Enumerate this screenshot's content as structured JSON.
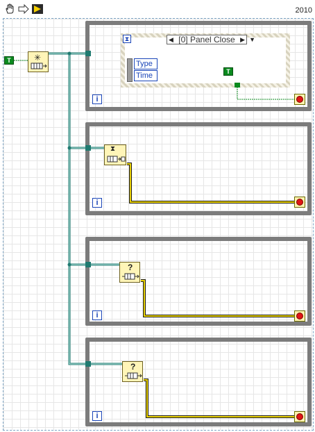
{
  "toolbar": {
    "icons": [
      "hand-cursor-icon",
      "arrow-right-icon",
      "run-icon"
    ],
    "year": "2010"
  },
  "diagram": {
    "bool_constant_label": "T",
    "event_structure": {
      "case_selector": "[0] Panel Close",
      "event_data_fields": [
        "Type",
        "Time"
      ],
      "inner_bool_label": "T"
    },
    "iteration_label": "i",
    "queue_nodes": [
      {
        "glyph": "✳",
        "name": "obtain-queue-node"
      },
      {
        "glyph": "⧗",
        "name": "release-queue-node"
      },
      {
        "glyph": "?",
        "name": "preview-queue-node"
      },
      {
        "glyph": "?",
        "name": "dequeue-node"
      }
    ],
    "colors": {
      "loop_border": "#7c7c7c",
      "queue_wire": "#1f7a70",
      "boolean_wire": "#0a8a1e",
      "error_wire": "#c8b400",
      "stop_button": "#e01515"
    }
  }
}
